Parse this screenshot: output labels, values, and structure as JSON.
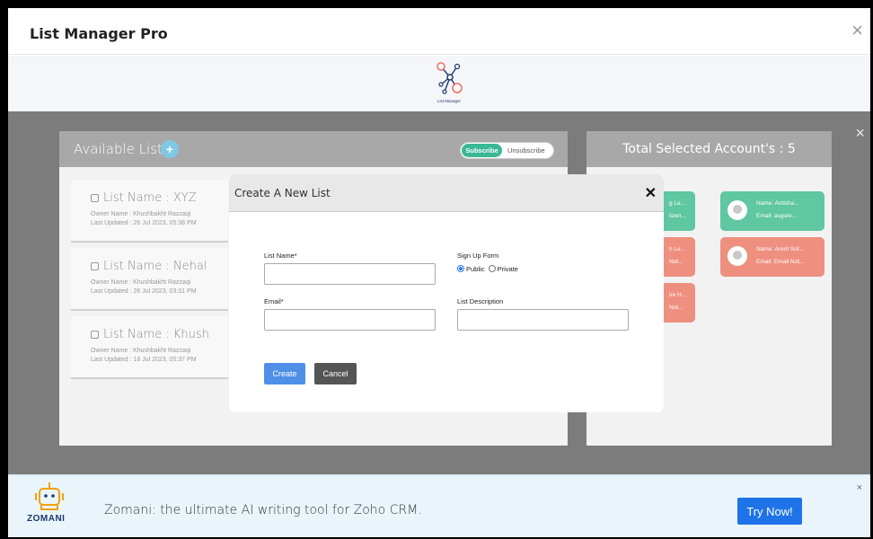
{
  "app": {
    "title": "List Manager Pro",
    "logo_caption": "List Manager"
  },
  "left_panel": {
    "title": "Available Lists",
    "add_icon": "+",
    "toggle": {
      "on_label": "Subscribe",
      "off_label": "Unsubscribe"
    },
    "lists": [
      {
        "name": "List Name : XYZ",
        "owner": "Owner Name : Khushbakht Razzaqi",
        "updated": "Last Updated : 26 Jul 2023, 05:38 PM"
      },
      {
        "name": "List Name : Nehal",
        "owner": "Owner Name : Khushbakht Razzaqi",
        "updated": "Last Updated : 26 Jul 2023, 03:31 PM"
      },
      {
        "name": "List Name : Khush",
        "owner": "Owner Name : Khushbakht Razzaqi",
        "updated": "Last Updated : 18 Jul 2023, 05:37 PM"
      }
    ]
  },
  "right_panel": {
    "title": "Total Selected Account's : 5",
    "accounts": [
      {
        "name": "g Le...",
        "email": "lizen...",
        "color": "green"
      },
      {
        "name": "Name: Antisha...",
        "email": "Email: asgure...",
        "color": "green"
      },
      {
        "name": "h Le...",
        "email": "Not...",
        "color": "red"
      },
      {
        "name": "Name: Arent Sof...",
        "email": "Email: Email Not...",
        "color": "red"
      },
      {
        "name": "ire H...",
        "email": "Not...",
        "color": "red"
      }
    ]
  },
  "modal": {
    "title": "Create A New List",
    "list_name_label": "List Name*",
    "signup_label": "Sign Up Form",
    "radio_public": "Public",
    "radio_private": "Private",
    "email_label": "Email*",
    "description_label": "List Description",
    "create_label": "Create",
    "cancel_label": "Cancel"
  },
  "banner": {
    "brand": "ZOMANI",
    "text": "Zomani: the ultimate AI writing tool for Zoho CRM.",
    "button": "Try Now!"
  },
  "colors": {
    "accent": "#3bb895",
    "primary_button": "#4f8fe8",
    "banner_button": "#1e73e8"
  },
  "icons": {
    "window_close": "close-icon",
    "panel_close": "close-icon",
    "modal_close": "close-icon",
    "logo": "network-icon",
    "banner_logo": "robot-icon"
  }
}
